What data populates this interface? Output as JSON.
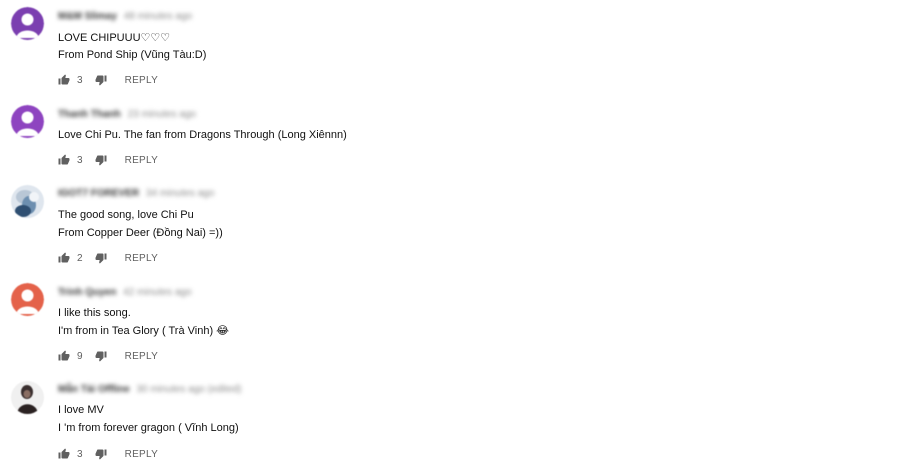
{
  "comments": [
    {
      "author": "M&M Slimay",
      "time": "48 minutes ago",
      "lines": [
        "LOVE CHIPUUU♡♡♡",
        "From Pond Ship (Vũng Tàu:D)"
      ],
      "likes": "3",
      "reply_label": "REPLY",
      "avatar_color": "#7b3fb0"
    },
    {
      "author": "Thanh Thanh",
      "time": "23 minutes ago",
      "lines": [
        "Love Chi Pu. The fan from Dragons Through (Long Xiênnn)"
      ],
      "likes": "3",
      "reply_label": "REPLY",
      "avatar_color": "#8e44c0"
    },
    {
      "author": "IGOT7 FOREVER",
      "time": "34 minutes ago",
      "lines": [
        "The good song, love Chi Pu",
        "From Copper Deer (Đồng Nai) =))"
      ],
      "likes": "2",
      "reply_label": "REPLY",
      "avatar_color": "#4a7fa8"
    },
    {
      "author": "Trinh Quyen",
      "time": "42 minutes ago",
      "lines": [
        "I like this song.",
        "I'm from in Tea Glory ( Trà Vinh) 😂"
      ],
      "likes": "9",
      "reply_label": "REPLY",
      "avatar_color": "#e4624a"
    },
    {
      "author": "Mẫn Tài Offline",
      "time": "30 minutes ago (edited)",
      "lines": [
        "I love MV",
        "I 'm from forever gragon ( Vĩnh Long)"
      ],
      "likes": "3",
      "reply_label": "REPLY",
      "avatar_color": "#3a2f2f"
    }
  ]
}
